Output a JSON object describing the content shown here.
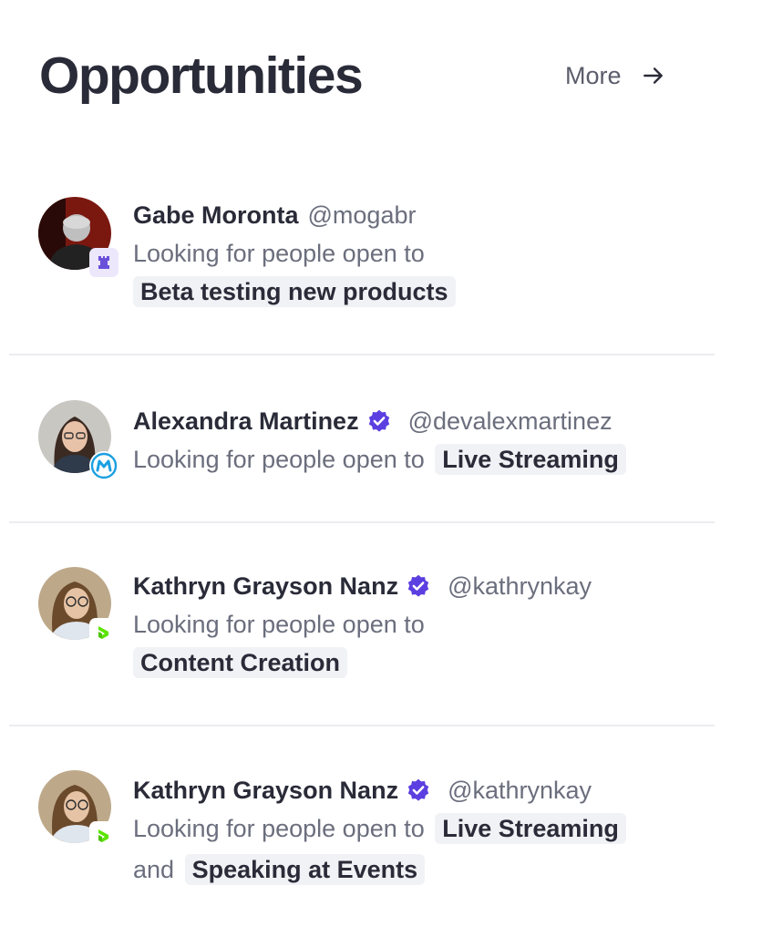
{
  "header": {
    "title": "Opportunities",
    "more_label": "More"
  },
  "colors": {
    "accent": "#5b3fe0",
    "tag_bg": "#f1f2f5",
    "text": "#2a2b38",
    "muted": "#6b6e7d"
  },
  "items": [
    {
      "name": "Gabe Moronta",
      "handle": "@mogabr",
      "verified": false,
      "intro": "Looking for people open to",
      "tags": [
        "Beta testing new products"
      ],
      "badge_icon": "chess-rook-icon"
    },
    {
      "name": "Alexandra Martinez",
      "handle": "@devalexmartinez",
      "verified": true,
      "intro": "Looking for people open to",
      "tags": [
        "Live Streaming"
      ],
      "badge_icon": "mulesoft-logo-icon"
    },
    {
      "name": "Kathryn Grayson Nanz",
      "handle": "@kathrynkay",
      "verified": true,
      "intro": "Looking for people open to",
      "tags": [
        "Content Creation"
      ],
      "badge_icon": "progress-logo-icon"
    },
    {
      "name": "Kathryn Grayson Nanz",
      "handle": "@kathrynkay",
      "verified": true,
      "intro": "Looking for people open to",
      "conjunction": "and",
      "tags": [
        "Live Streaming",
        "Speaking at Events"
      ],
      "badge_icon": "progress-logo-icon"
    }
  ]
}
